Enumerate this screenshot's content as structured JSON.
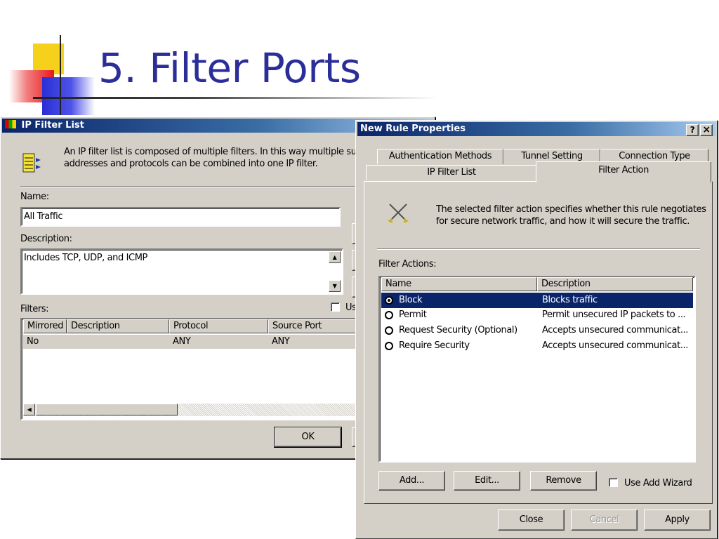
{
  "slide": {
    "title": "5. Filter Ports"
  },
  "ip_filter_list": {
    "title": "IP Filter List",
    "intro_line1": "An IP filter list is composed of multiple filters. In this way multiple subne",
    "intro_line2": "addresses and protocols can be combined into one IP filter.",
    "name_label": "Name:",
    "name_value": "All Traffic",
    "description_label": "Description:",
    "description_value": "Includes TCP, UDP, and ICMP",
    "filters_label": "Filters:",
    "use_wizard_label": "Us",
    "columns": [
      "Mirrored",
      "Description",
      "Protocol",
      "Source Port"
    ],
    "rows": [
      {
        "mirrored": "No",
        "description": "",
        "protocol": "ANY",
        "source_port": "ANY"
      }
    ],
    "ok_label": "OK"
  },
  "rule_props": {
    "title": "New Rule Properties",
    "help_label": "?",
    "close_label": "×",
    "tabs_back": [
      "Authentication Methods",
      "Tunnel Setting",
      "Connection Type"
    ],
    "tabs_front": [
      "IP Filter List",
      "Filter Action"
    ],
    "active_tab": "Filter Action",
    "info_line1": "The selected filter action specifies whether this rule negotiates",
    "info_line2": "for secure network traffic, and how it will secure the traffic.",
    "filter_actions_label": "Filter Actions:",
    "columns": [
      "Name",
      "Description"
    ],
    "actions": [
      {
        "name": "Block",
        "description": "Blocks traffic",
        "selected": true
      },
      {
        "name": "Permit",
        "description": "Permit unsecured IP packets to ...",
        "selected": false
      },
      {
        "name": "Request Security (Optional)",
        "description": "Accepts unsecured communicat...",
        "selected": false
      },
      {
        "name": "Require Security",
        "description": "Accepts unsecured communicat...",
        "selected": false
      }
    ],
    "add_label": "Add...",
    "edit_label": "Edit...",
    "remove_label": "Remove",
    "use_add_wizard_label": "Use Add Wizard",
    "use_add_wizard_checked": false,
    "close_button_label": "Close",
    "cancel_label": "Cancel",
    "apply_label": "Apply"
  },
  "icons": {
    "filter_list_icon": "filter-list-icon",
    "filter_action_icon": "crossed-tools-icon"
  }
}
